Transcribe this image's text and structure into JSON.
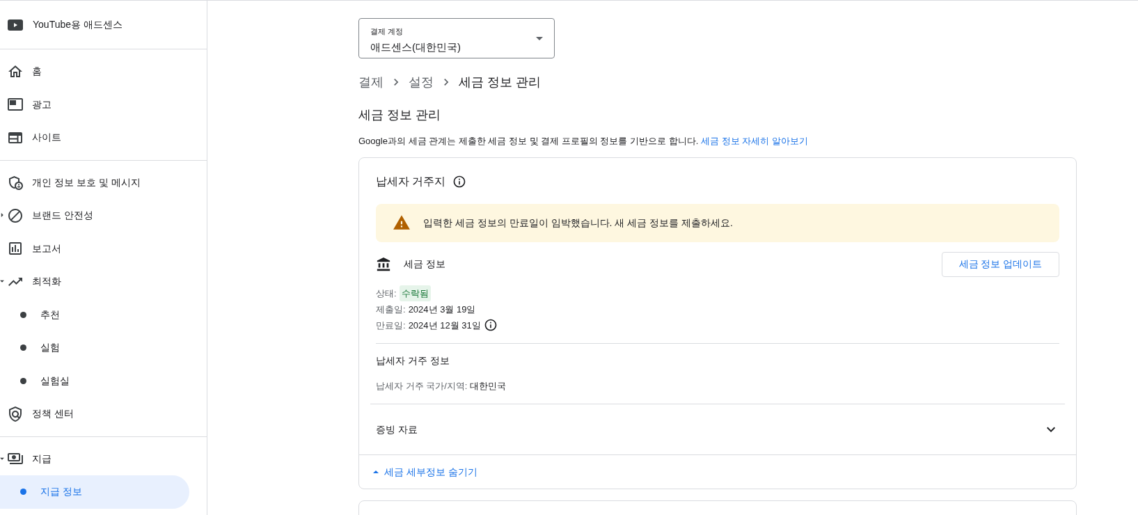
{
  "sidebar": {
    "title": "YouTube용 애드센스",
    "sections": [
      [
        {
          "label": "홈",
          "selected": false
        },
        {
          "label": "광고",
          "selected": false
        },
        {
          "label": "사이트",
          "selected": false
        }
      ],
      [
        {
          "label": "개인 정보 보호 및 메시지",
          "selected": false
        },
        {
          "label": "브랜드 안전성",
          "selected": false,
          "expanded": false
        },
        {
          "label": "보고서",
          "selected": false
        },
        {
          "label": "최적화",
          "selected": false,
          "expanded": true,
          "children": [
            {
              "label": "추천",
              "selected": false
            },
            {
              "label": "실험",
              "selected": false
            },
            {
              "label": "실험실",
              "selected": false
            }
          ]
        },
        {
          "label": "정책 센터",
          "selected": false
        }
      ],
      [
        {
          "label": "지급",
          "selected": false,
          "expanded": true,
          "children": [
            {
              "label": "지급 정보",
              "selected": true
            }
          ]
        }
      ]
    ]
  },
  "account_select": {
    "label": "결제 계정",
    "value": "애드센스(대한민국)"
  },
  "breadcrumb": [
    "결제",
    "설정",
    "세금 정보 관리"
  ],
  "page_title": "세금 정보 관리",
  "description": {
    "text": "Google과의 세금 관계는 제출한 세금 정보 및 결제 프로필의 정보를 기반으로 합니다.",
    "link": "세금 정보 자세히 알아보기"
  },
  "card": {
    "title": "납세자 거주지",
    "warning": "입력한 세금 정보의 만료일이 임박했습니다. 새 세금 정보를 제출하세요.",
    "tax_info": {
      "title": "세금 정보",
      "button": "세금 정보 업데이트",
      "status_label": "상태:",
      "status": "수락됨",
      "submitted_label": "제출일:",
      "submitted": "2024년 3월 19일",
      "expires_label": "만료일:",
      "expires": "2024년 12월 31일"
    },
    "residence": {
      "title": "납세자 거주 정보",
      "country_label": "납세자 거주 국가/지역:",
      "country": "대한민국"
    },
    "documents": {
      "title": "증빙 자료",
      "expanded": false
    },
    "toggle": {
      "label": "세금 세부정보 숨기기",
      "expanded": true
    }
  }
}
